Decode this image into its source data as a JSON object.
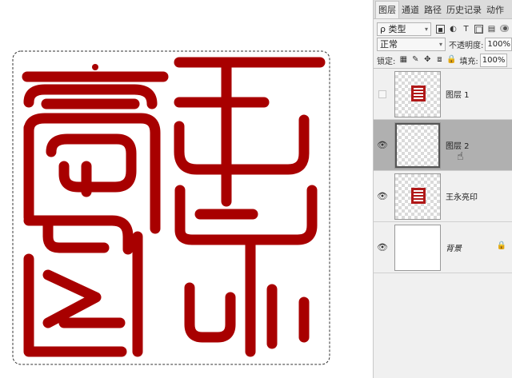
{
  "layers_panel": {
    "tabs": [
      {
        "label": "图层",
        "active": true
      },
      {
        "label": "通道"
      },
      {
        "label": "路径"
      },
      {
        "label": "历史记录"
      },
      {
        "label": "动作"
      }
    ],
    "filter": {
      "kind_label": "ρ 类型",
      "icons": [
        "image-filter-icon",
        "adjustment-filter-icon",
        "type-filter-icon",
        "shape-filter-icon",
        "smart-object-filter-icon",
        "filter-toggle-icon"
      ]
    },
    "blend_mode": "正常",
    "opacity_label": "不透明度:",
    "opacity_value": "100%",
    "lock_label": "锁定:",
    "fill_label": "填充:",
    "fill_value": "100%",
    "layers": [
      {
        "name": "图层 1",
        "visible": false,
        "thumbnail": "seal",
        "selected": false
      },
      {
        "name": "图层 2",
        "visible": true,
        "thumbnail": "empty",
        "selected": true
      },
      {
        "name": "王永亮印",
        "visible": true,
        "thumbnail": "seal",
        "selected": false
      },
      {
        "name": "背景",
        "visible": true,
        "thumbnail": "white",
        "selected": false,
        "locked": true
      }
    ]
  },
  "canvas": {
    "seal_color": "#a80000"
  }
}
